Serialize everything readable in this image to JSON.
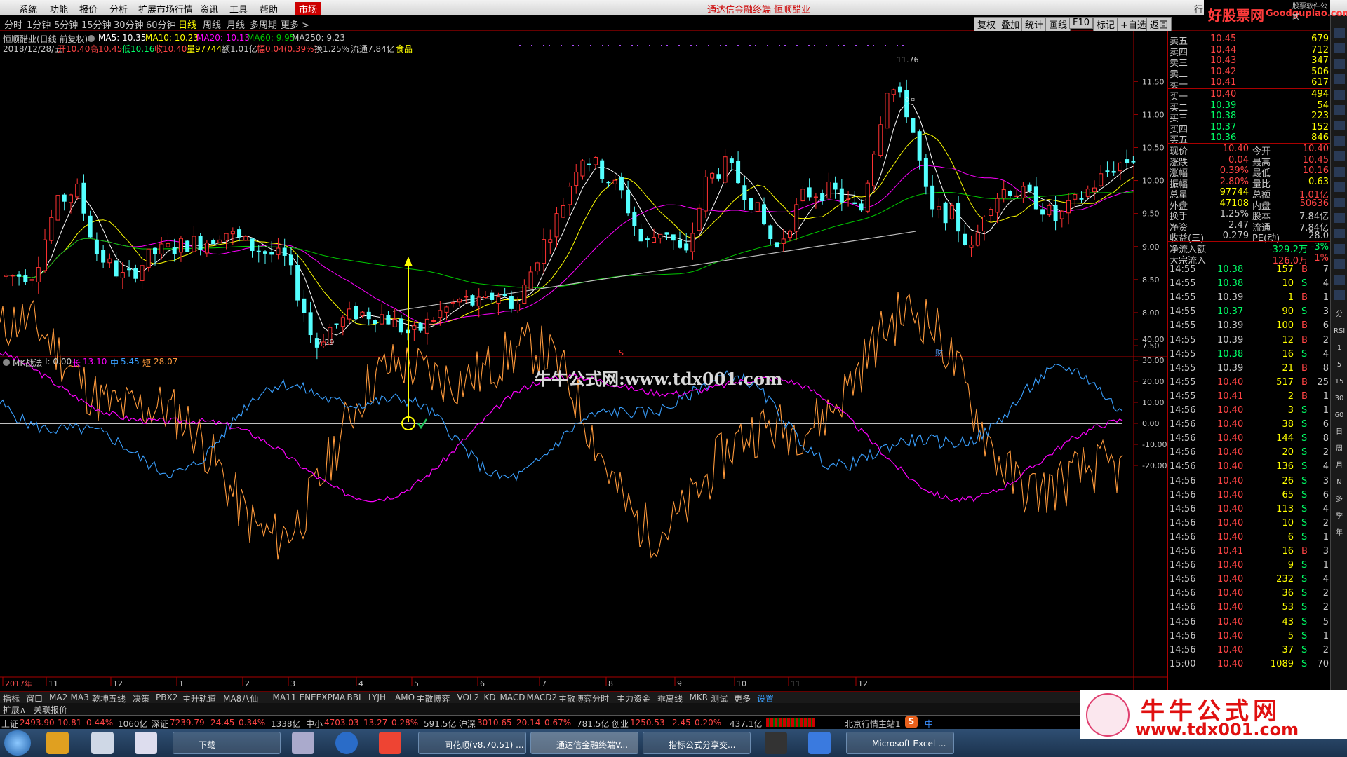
{
  "menubar": {
    "items": [
      "系统",
      "功能",
      "报价",
      "分析",
      "扩展市场行情",
      "资讯",
      "工具",
      "帮助"
    ],
    "active": "市场",
    "title": "通达信金融终端  恒顺醋业",
    "corner": "行",
    "brand": "好股票网",
    "brand_url": "Goodgupiao.com",
    "brand_small": "股票软件公式"
  },
  "toolbar": {
    "periods": [
      "分时",
      "1分钟",
      "5分钟",
      "15分钟",
      "30分钟",
      "60分钟",
      "日线",
      "周线",
      "月线",
      "多周期",
      "更多 >"
    ],
    "active": "日线",
    "right": [
      "复权",
      "叠加",
      "统计",
      "画线",
      "F10",
      "标记",
      "+自选",
      "返回"
    ]
  },
  "chart_info": {
    "stock": "恒顺醋业(日线 前复权)",
    "ma5": "MA5: 10.35",
    "ma10": "MA10: 10.23",
    "ma20": "MA20: 10.13",
    "ma60": "MA60: 9.95",
    "ma250": "MA250: 9.23",
    "date": "2018/12/28/五",
    "open": "开10.40",
    "high": "高10.45",
    "low": "低10.16",
    "close": "收10.40",
    "vol": "量97744",
    "amt": "额1.01亿",
    "chg": "幅0.04(0.39%)",
    "turn": "换1.25%",
    "float": "流通7.84亿",
    "sector": "食品",
    "high_mark": "11.76",
    "low_mark": "7.29",
    "marker_s": "S",
    "marker_cai": "财"
  },
  "chart_data": {
    "type": "candlestick",
    "price_axis": [
      "11.50",
      "11.00",
      "10.50",
      "10.00",
      "9.50",
      "9.00",
      "8.50",
      "8.00",
      "7.50"
    ],
    "ylim": [
      7.32,
      11.97
    ],
    "indicator_name": "MK战法",
    "indicator_param": "I: 0.00",
    "series": [
      {
        "name": "长",
        "value": "13.10"
      },
      {
        "name": "中",
        "value": "5.45"
      },
      {
        "name": "短",
        "value": "28.07"
      }
    ],
    "indicator_axis": [
      "40.00",
      "30.00",
      "20.00",
      "10.00",
      "0.00",
      "-10.00",
      "-20.00"
    ],
    "time_axis": [
      "2017年",
      "11",
      "12",
      "1",
      "2",
      "3",
      "4",
      "5",
      "6",
      "7",
      "8",
      "9",
      "10",
      "11",
      "12"
    ],
    "candles_visible": 175
  },
  "watermark": "牛牛公式网:www.tdx001.com",
  "orderbook": {
    "sells": [
      [
        "卖五",
        "10.45",
        "679"
      ],
      [
        "卖四",
        "10.44",
        "712"
      ],
      [
        "卖三",
        "10.43",
        "347"
      ],
      [
        "卖二",
        "10.42",
        "506"
      ],
      [
        "卖一",
        "10.41",
        "617"
      ]
    ],
    "buys": [
      [
        "买一",
        "10.40",
        "494"
      ],
      [
        "买二",
        "10.39",
        "54"
      ],
      [
        "买三",
        "10.38",
        "223"
      ],
      [
        "买四",
        "10.37",
        "152"
      ],
      [
        "买五",
        "10.36",
        "846"
      ]
    ]
  },
  "quote": [
    [
      "现价",
      "10.40",
      "今开",
      "10.40"
    ],
    [
      "涨跌",
      "0.04",
      "最高",
      "10.45"
    ],
    [
      "涨幅",
      "0.39%",
      "最低",
      "10.16"
    ],
    [
      "振幅",
      "2.80%",
      "量比",
      "0.63"
    ],
    [
      "总量",
      "97744",
      "总额",
      "1.01亿"
    ],
    [
      "外盘",
      "47108",
      "内盘",
      "50636"
    ],
    [
      "换手",
      "1.25%",
      "股本",
      "7.84亿"
    ],
    [
      "净资",
      "2.47",
      "流通",
      "7.84亿"
    ],
    [
      "收益(三)",
      "0.279",
      "PE(动)",
      "28.0"
    ]
  ],
  "flows": [
    [
      "净流入额",
      "-329.2万",
      "-3%"
    ],
    [
      "大宗流入",
      "126.0万",
      "1%"
    ]
  ],
  "ticks": [
    [
      "14:55",
      "10.38",
      "157",
      "B",
      "7"
    ],
    [
      "14:55",
      "10.38",
      "10",
      "S",
      "4"
    ],
    [
      "14:55",
      "10.39",
      "1",
      "B",
      "1"
    ],
    [
      "14:55",
      "10.37",
      "90",
      "S",
      "3"
    ],
    [
      "14:55",
      "10.39",
      "100",
      "B",
      "6"
    ],
    [
      "14:55",
      "10.39",
      "12",
      "B",
      "2"
    ],
    [
      "14:55",
      "10.38",
      "16",
      "S",
      "4"
    ],
    [
      "14:55",
      "10.39",
      "21",
      "B",
      "8"
    ],
    [
      "14:55",
      "10.40",
      "517",
      "B",
      "25"
    ],
    [
      "14:55",
      "10.41",
      "2",
      "B",
      "1"
    ],
    [
      "14:56",
      "10.40",
      "3",
      "S",
      "1"
    ],
    [
      "14:56",
      "10.40",
      "38",
      "S",
      "6"
    ],
    [
      "14:56",
      "10.40",
      "144",
      "S",
      "8"
    ],
    [
      "14:56",
      "10.40",
      "20",
      "S",
      "2"
    ],
    [
      "14:56",
      "10.40",
      "136",
      "S",
      "4"
    ],
    [
      "14:56",
      "10.40",
      "26",
      "S",
      "3"
    ],
    [
      "14:56",
      "10.40",
      "65",
      "S",
      "6"
    ],
    [
      "14:56",
      "10.40",
      "113",
      "S",
      "4"
    ],
    [
      "14:56",
      "10.40",
      "10",
      "S",
      "2"
    ],
    [
      "14:56",
      "10.40",
      "6",
      "S",
      "1"
    ],
    [
      "14:56",
      "10.41",
      "16",
      "B",
      "3"
    ],
    [
      "14:56",
      "10.40",
      "9",
      "S",
      "1"
    ],
    [
      "14:56",
      "10.40",
      "232",
      "S",
      "4"
    ],
    [
      "14:56",
      "10.40",
      "36",
      "S",
      "2"
    ],
    [
      "14:56",
      "10.40",
      "53",
      "S",
      "2"
    ],
    [
      "14:56",
      "10.40",
      "43",
      "S",
      "5"
    ],
    [
      "14:56",
      "10.40",
      "5",
      "S",
      "1"
    ],
    [
      "14:56",
      "10.40",
      "37",
      "S",
      "2"
    ],
    [
      "15:00",
      "10.40",
      "1089",
      "S",
      "70"
    ]
  ],
  "right_icons": [
    "分",
    "RSI",
    "1",
    "5",
    "15",
    "30",
    "60",
    "日",
    "周",
    "月",
    "N",
    "多",
    "季",
    "年"
  ],
  "tabs": [
    "指标",
    "窗口",
    "MA2",
    "MA3",
    "乾坤五线",
    "决策",
    "PBX2",
    "主升轨道",
    "MA8八仙",
    "MA11",
    "ENEEXPMA",
    "BBI",
    "LYJH",
    "AMO",
    "主散博弈",
    "VOL2",
    "KD",
    "MACD",
    "MACD2",
    "主散博弈分时",
    "主力资金",
    "乖离线",
    "MKR",
    "测试",
    "更多",
    "设置"
  ],
  "tab_right": "日线",
  "tabs2": [
    "扩展∧",
    "关联报价"
  ],
  "status": {
    "sh": "上证",
    "sh_val": "2493.90",
    "sh_chg": "10.81",
    "sh_pct": "0.44%",
    "sh_amt": "1060亿",
    "sz": "深证",
    "sz_val": "7239.79",
    "sz_chg": "24.45",
    "sz_pct": "0.34%",
    "sz_amt": "1338亿",
    "zx": "中小",
    "zx_val": "4703.03",
    "zx_chg": "13.27",
    "zx_pct": "0.28%",
    "zx_amt": "591.5亿",
    "hs": "沪深",
    "hs_val": "3010.65",
    "hs_chg": "20.14",
    "hs_pct": "0.67%",
    "hs_amt": "781.5亿",
    "cy": "创业",
    "cy_val": "1250.53",
    "cy_chg": "2.45",
    "cy_pct": "0.20%",
    "cy_amt": "437.1亿",
    "station": "北京行情主站1",
    "ime": "中"
  },
  "taskbar": {
    "items": [
      "下载",
      "同花顺(v8.70.51) ...",
      "通达信金融终端V...",
      "指标公式分享交...",
      "Microsoft Excel ..."
    ]
  },
  "corner_ad": {
    "title": "牛牛公式网",
    "url": "www.tdx001.com"
  },
  "colors": {
    "up": "#ff3232",
    "down": "#54ffff",
    "ma5": "#ffffff",
    "ma10": "#ffff00",
    "ma20": "#ff00ff",
    "ma60": "#00c800",
    "ma250": "#c0c0c0",
    "long": "#ff00ff",
    "mid": "#3aa0ff",
    "short": "#ff9a3c"
  }
}
